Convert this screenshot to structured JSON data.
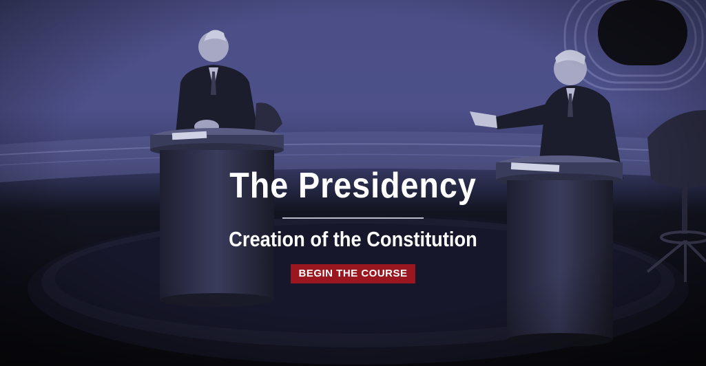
{
  "hero": {
    "title": "The Presidency",
    "subtitle": "Creation of the Constitution",
    "cta_label": "BEGIN THE COURSE",
    "background_image": "historic-debate-photo",
    "colors": {
      "overlay_tint": "#4b4e86",
      "cta_background": "#9a1720",
      "text": "#ffffff",
      "divider": "#b9bcc8"
    }
  }
}
